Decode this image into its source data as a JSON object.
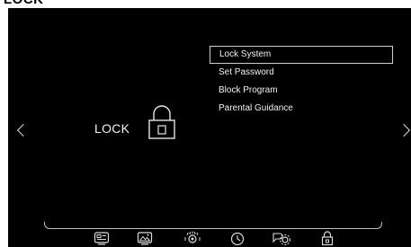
{
  "page": {
    "title": "LOCK"
  },
  "main": {
    "lock_label": "LOCK"
  },
  "menu": {
    "items": [
      {
        "label": "Lock System",
        "selected": true
      },
      {
        "label": "Set Password",
        "selected": false
      },
      {
        "label": "Block Program",
        "selected": false
      },
      {
        "label": "Parental Guidance",
        "selected": false
      }
    ]
  },
  "bottom_bar": {
    "icons": [
      "channel-icon",
      "picture-icon",
      "sound-icon",
      "time-icon",
      "setup-icon",
      "lock-icon"
    ],
    "active": "lock-icon"
  },
  "colors": {
    "background": "#000000",
    "text": "#f2f2f2",
    "selection_border": "#cfcfcf"
  }
}
